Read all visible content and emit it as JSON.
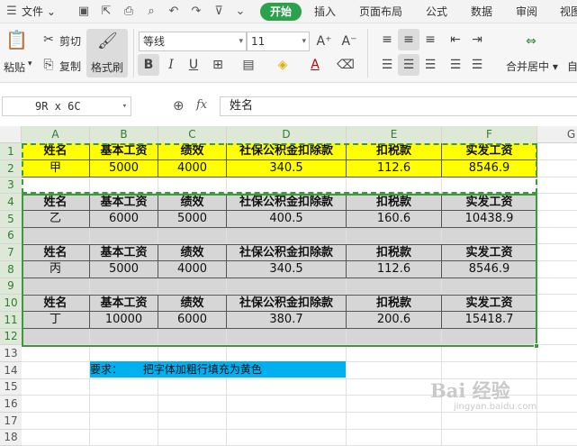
{
  "menubar": {
    "file": "文件",
    "tabs": [
      "开始",
      "插入",
      "页面布局",
      "公式",
      "数据",
      "审阅",
      "视图"
    ]
  },
  "ribbon": {
    "paste": "粘贴",
    "cut": "剪切",
    "copy": "复制",
    "format_painter": "格式刷",
    "font_name": "等线",
    "font_size": "11",
    "bold": "B",
    "italic": "I",
    "underline": "U",
    "merge_center": "合并居中",
    "auto_wrap": "自"
  },
  "formula_bar": {
    "name_box": "9R x 6C",
    "fx": "fx",
    "content": "姓名"
  },
  "columns": [
    "A",
    "B",
    "C",
    "D",
    "E",
    "F",
    "G"
  ],
  "rows": [
    "1",
    "2",
    "3",
    "4",
    "5",
    "6",
    "7",
    "8",
    "9",
    "10",
    "11",
    "12",
    "13",
    "14",
    "15",
    "16",
    "17",
    "18"
  ],
  "table": {
    "headers": [
      "姓名",
      "基本工资",
      "绩效",
      "社保公积金扣除款",
      "扣税款",
      "实发工资"
    ],
    "records": [
      [
        "甲",
        "5000",
        "4000",
        "340.5",
        "112.6",
        "8546.9"
      ],
      [
        "乙",
        "6000",
        "5000",
        "400.5",
        "160.6",
        "10438.9"
      ],
      [
        "丙",
        "5000",
        "4000",
        "340.5",
        "112.6",
        "8546.9"
      ],
      [
        "丁",
        "10000",
        "6000",
        "380.7",
        "200.6",
        "15418.7"
      ]
    ]
  },
  "note": "要求：      把字体加粗行填充为黄色",
  "colors": {
    "active_tab": "#2aa14a",
    "header_fill": "#ffff00",
    "selection_fill": "#d6d6d6",
    "selection_border": "#3c9a3c",
    "note_fill": "#00b0f0"
  },
  "watermark": {
    "main": "Bai 经验",
    "sub": "jingyan.baidu.com"
  }
}
